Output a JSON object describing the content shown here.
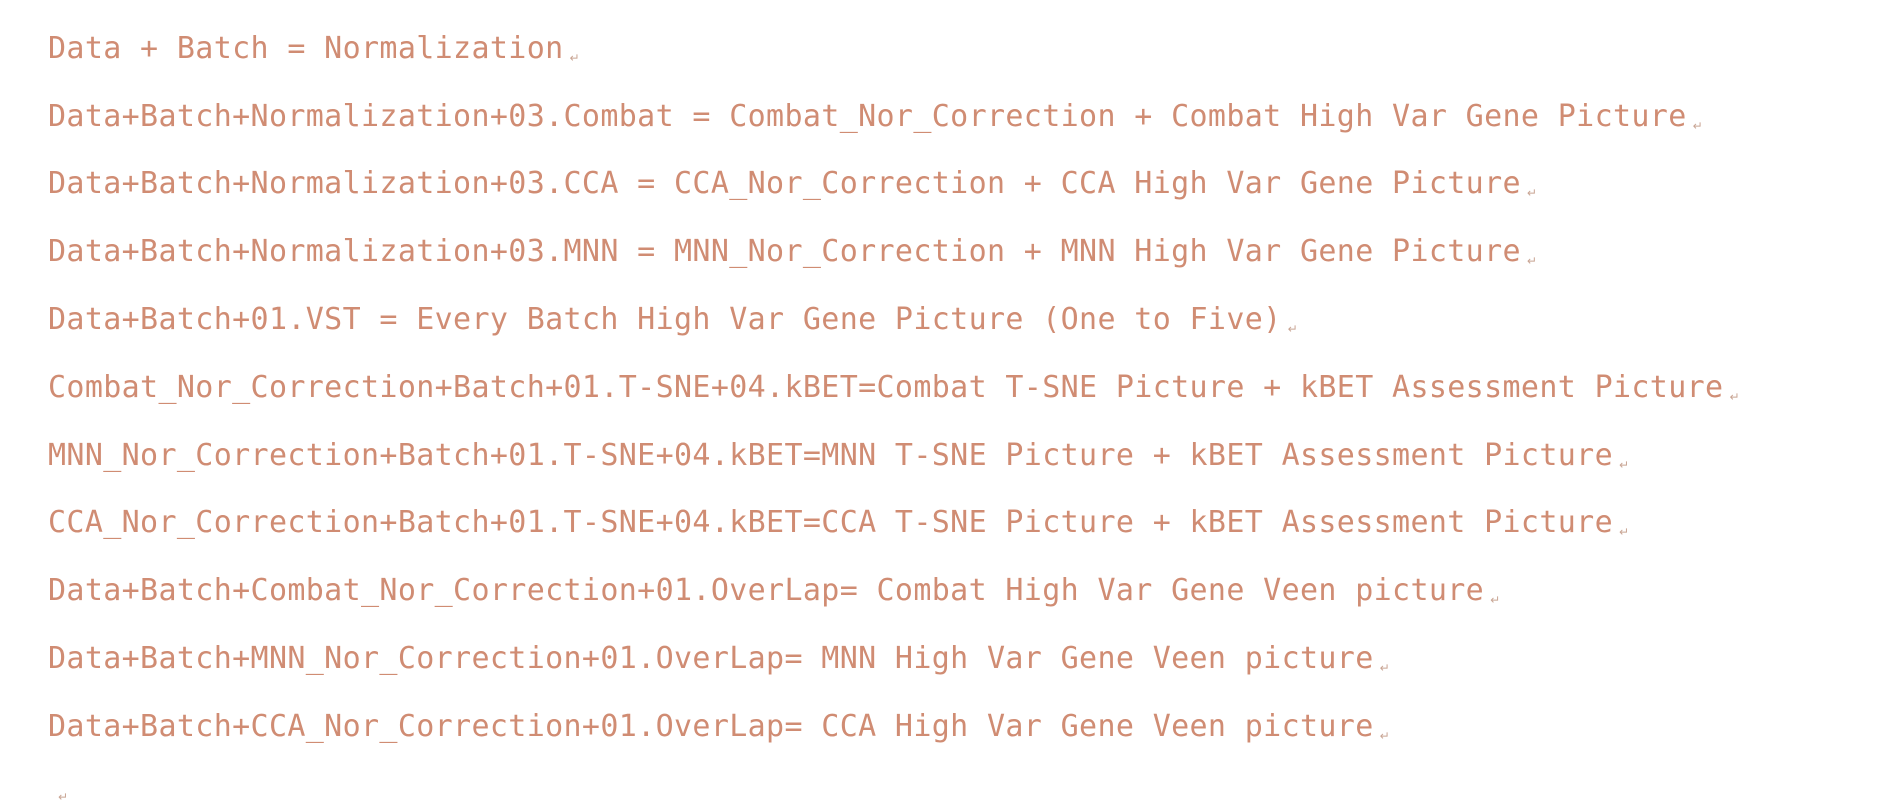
{
  "document": {
    "paragraph_mark": "↵",
    "lines": [
      "Data + Batch = Normalization",
      "Data+Batch+Normalization+03.Combat = Combat_Nor_Correction + Combat High Var Gene Picture",
      "Data+Batch+Normalization+03.CCA = CCA_Nor_Correction + CCA High Var Gene Picture",
      "Data+Batch+Normalization+03.MNN = MNN_Nor_Correction + MNN High Var Gene Picture",
      "Data+Batch+01.VST = Every Batch High Var Gene Picture (One to Five)",
      "Combat_Nor_Correction+Batch+01.T-SNE+04.kBET=Combat T-SNE Picture + kBET Assessment Picture",
      "MNN_Nor_Correction+Batch+01.T-SNE+04.kBET=MNN T-SNE Picture + kBET Assessment Picture",
      "CCA_Nor_Correction+Batch+01.T-SNE+04.kBET=CCA T-SNE Picture + kBET Assessment Picture",
      "Data+Batch+Combat_Nor_Correction+01.OverLap= Combat High Var Gene Veen picture",
      "Data+Batch+MNN_Nor_Correction+01.OverLap= MNN High Var Gene Veen picture",
      "Data+Batch+CCA_Nor_Correction+01.OverLap= CCA High Var Gene Veen picture"
    ]
  },
  "colors": {
    "text": "#d08c73",
    "mark": "#c9a594",
    "background": "#ffffff"
  }
}
